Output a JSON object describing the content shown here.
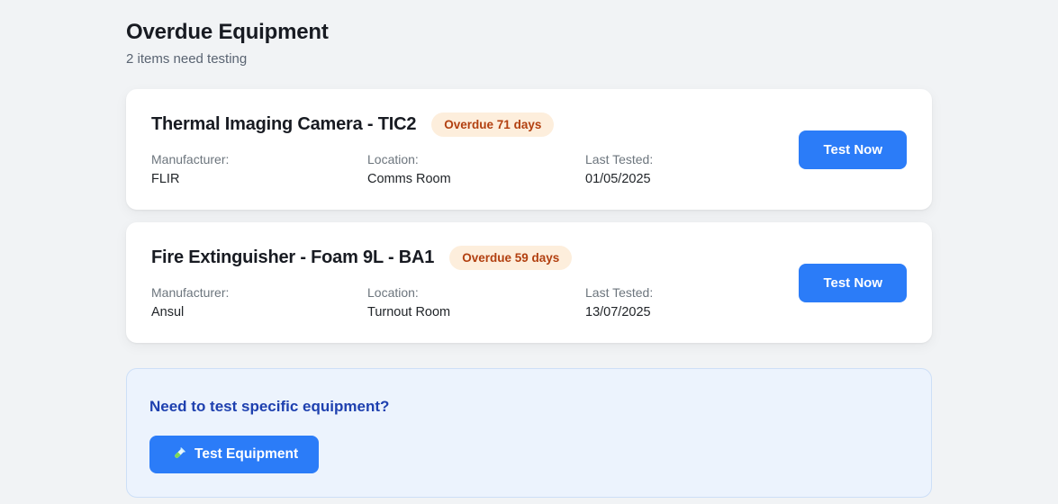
{
  "page": {
    "title": "Overdue Equipment",
    "subtitle": "2 items need testing"
  },
  "cards": [
    {
      "title": "Thermal Imaging Camera - TIC2",
      "badge": "Overdue 71 days",
      "fields": [
        {
          "label": "Manufacturer:",
          "value": "FLIR"
        },
        {
          "label": "Location:",
          "value": "Comms Room"
        },
        {
          "label": "Last Tested:",
          "value": "01/05/2025"
        }
      ],
      "action_label": "Test Now"
    },
    {
      "title": "Fire Extinguisher - Foam 9L - BA1",
      "badge": "Overdue 59 days",
      "fields": [
        {
          "label": "Manufacturer:",
          "value": "Ansul"
        },
        {
          "label": "Location:",
          "value": "Turnout Room"
        },
        {
          "label": "Last Tested:",
          "value": "13/07/2025"
        }
      ],
      "action_label": "Test Now"
    }
  ],
  "panel": {
    "heading": "Need to test specific equipment?",
    "button_label": "Test Equipment",
    "button_icon": "test-tube-icon"
  },
  "colors": {
    "primary_button": "#2b7cf8",
    "badge_bg": "#fdeedc",
    "badge_text": "#b24010",
    "panel_bg": "#ecf3fd",
    "panel_border": "#cddff7",
    "panel_heading": "#1e40af",
    "page_bg": "#f1f3f5",
    "card_bg": "#ffffff"
  }
}
